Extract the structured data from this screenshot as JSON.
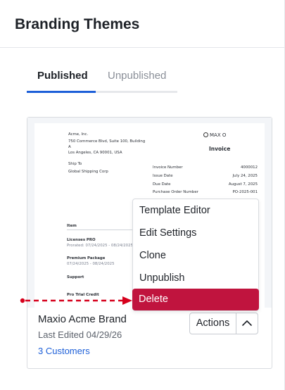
{
  "page": {
    "title": "Branding Themes"
  },
  "tabs": [
    {
      "label": "Published",
      "active": true
    },
    {
      "label": "Unpublished",
      "active": false
    }
  ],
  "colors": {
    "accent": "#1d5fd8",
    "danger": "#c0143e",
    "pointer": "#d6001c"
  },
  "preview": {
    "company": "Acme, Inc.",
    "address1": "750 Commerce Blvd, Suite 100, Building",
    "address2": "A",
    "city": "Los Angeles, CA 90001, USA",
    "logo_text": "MAX O",
    "doc_title": "Invoice",
    "ship_to_label": "Ship To",
    "ship_to_value": "Global Shipping Corp",
    "meta": [
      {
        "label": "Invoice Number",
        "value": "4000012"
      },
      {
        "label": "Issue Date",
        "value": "July 24, 2025"
      },
      {
        "label": "Due Date",
        "value": "August 7, 2025"
      },
      {
        "label": "Purchase Order Number",
        "value": "PO-2025-001"
      }
    ],
    "item_header": "Item",
    "lines": [
      {
        "name": "Licenses PRO",
        "detail": "Prorated: 07/24/2025 - 08/24/2025"
      },
      {
        "name": "Premium Package",
        "detail": "07/24/2025 - 08/24/2025"
      },
      {
        "name": "Support",
        "detail": ""
      },
      {
        "name": "Pro Trial Credit",
        "detail": ""
      }
    ]
  },
  "card": {
    "name": "Maxio Acme Brand",
    "last_edited": "Last Edited 04/29/26",
    "customers": "3 Customers",
    "actions_label": "Actions"
  },
  "menu": {
    "items": [
      "Template Editor",
      "Edit Settings",
      "Clone",
      "Unpublish",
      "Delete"
    ]
  },
  "icons": {
    "actions_toggle": "chevron-up-icon",
    "logo": "circle-logo-icon",
    "pointer": "dashed-arrow-icon"
  }
}
